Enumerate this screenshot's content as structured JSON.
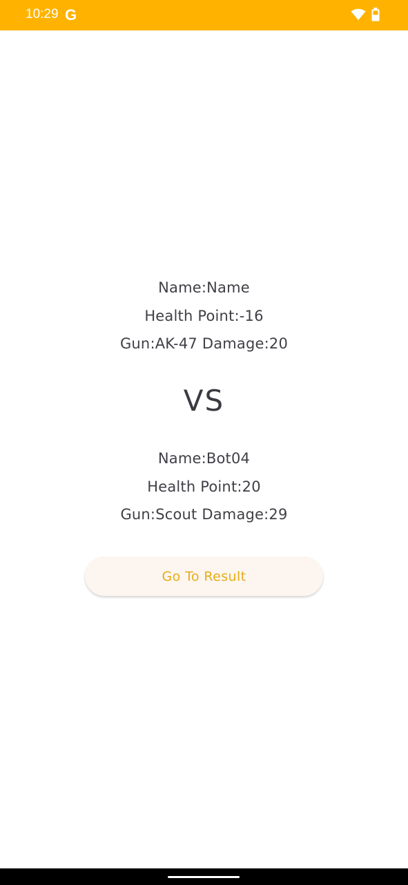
{
  "status_bar": {
    "time": "10:29",
    "g_glyph": "G",
    "background": "#ffb300"
  },
  "player1": {
    "name_line": "Name:Name",
    "health_line": "Health Point:-16",
    "gun_line": "Gun:AK-47 Damage:20"
  },
  "vs_label": "VS",
  "player2": {
    "name_line": "Name:Bot04",
    "health_line": "Health Point:20",
    "gun_line": "Gun:Scout Damage:29"
  },
  "result_button": {
    "label": "Go To Result",
    "text_color": "#e5ad16"
  }
}
